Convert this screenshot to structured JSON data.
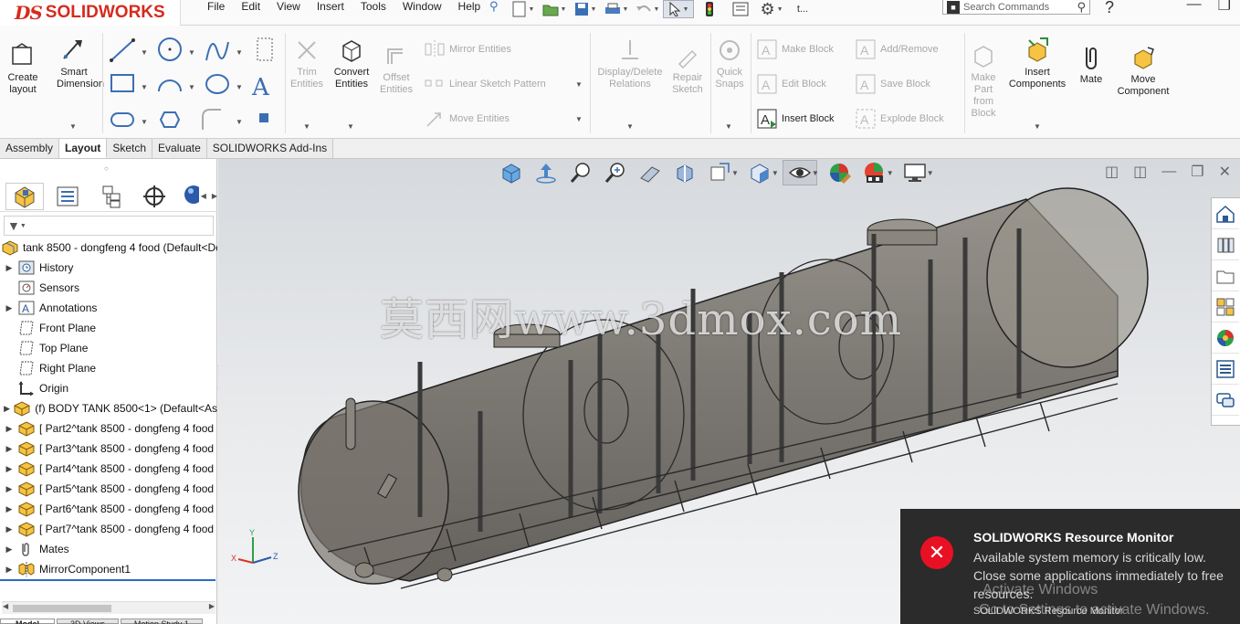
{
  "app": {
    "brand_prefix": "DS",
    "brand_name": "SOLIDWORKS"
  },
  "menu": [
    "File",
    "Edit",
    "View",
    "Insert",
    "Tools",
    "Window",
    "Help"
  ],
  "quickbar": {
    "truncated_label": "t..."
  },
  "search": {
    "placeholder": "Search Commands"
  },
  "ribbon": {
    "create_layout": "Create\nlayout",
    "smart_dimension": "Smart\nDimension",
    "trim_entities": "Trim\nEntities",
    "convert_entities": "Convert\nEntities",
    "offset_entities": "Offset\nEntities",
    "mirror_entities": "Mirror Entities",
    "linear_sketch_pattern": "Linear Sketch Pattern",
    "move_entities": "Move Entities",
    "display_delete_relations": "Display/Delete\nRelations",
    "repair_sketch": "Repair\nSketch",
    "quick_snaps": "Quick\nSnaps",
    "make_block": "Make Block",
    "edit_block": "Edit Block",
    "insert_block": "Insert Block",
    "add_remove": "Add/Remove",
    "save_block": "Save Block",
    "explode_block": "Explode Block",
    "make_part_from_block": "Make\nPart\nfrom\nBlock",
    "insert_components": "Insert\nComponents",
    "mate": "Mate",
    "move_component": "Move\nComponent"
  },
  "tabs": [
    {
      "label": "Assembly",
      "active": false
    },
    {
      "label": "Layout",
      "active": true
    },
    {
      "label": "Sketch",
      "active": false
    },
    {
      "label": "Evaluate",
      "active": false
    },
    {
      "label": "SOLIDWORKS Add-Ins",
      "active": false
    }
  ],
  "tree": {
    "root": "tank 8500 - dongfeng 4 food  (Default<Def",
    "items": [
      {
        "label": "History",
        "icon": "history-icon",
        "arrow": true
      },
      {
        "label": "Sensors",
        "icon": "sensors-icon",
        "arrow": false
      },
      {
        "label": "Annotations",
        "icon": "annotations-icon",
        "arrow": true
      },
      {
        "label": "Front Plane",
        "icon": "plane-icon",
        "arrow": false
      },
      {
        "label": "Top Plane",
        "icon": "plane-icon",
        "arrow": false
      },
      {
        "label": "Right Plane",
        "icon": "plane-icon",
        "arrow": false
      },
      {
        "label": "Origin",
        "icon": "origin-icon",
        "arrow": false
      },
      {
        "label": "(f) BODY TANK 8500<1> (Default<As",
        "icon": "part-icon",
        "arrow": true
      },
      {
        "label": "[ Part2^tank 8500 - dongfeng 4 food",
        "icon": "part-icon",
        "arrow": true
      },
      {
        "label": "[ Part3^tank 8500 - dongfeng 4 food",
        "icon": "part-icon",
        "arrow": true
      },
      {
        "label": "[ Part4^tank 8500 - dongfeng 4 food",
        "icon": "part-icon",
        "arrow": true
      },
      {
        "label": "[ Part5^tank 8500 - dongfeng 4 food",
        "icon": "part-icon",
        "arrow": true
      },
      {
        "label": "[ Part6^tank 8500 - dongfeng 4 food",
        "icon": "part-icon",
        "arrow": true
      },
      {
        "label": "[ Part7^tank 8500 - dongfeng 4 food",
        "icon": "part-icon",
        "arrow": true
      },
      {
        "label": "Mates",
        "icon": "mates-icon",
        "arrow": true
      },
      {
        "label": "MirrorComponent1",
        "icon": "mirror-component-icon",
        "arrow": true
      }
    ]
  },
  "bottom_tabs": [
    "Model",
    "3D Views",
    "Motion Study 1"
  ],
  "viewport": {
    "watermark": "莫西网www.3dmox.com",
    "triad": {
      "x": "X",
      "y": "Y",
      "z": "Z"
    }
  },
  "notification": {
    "title": "SOLIDWORKS Resource Monitor",
    "body": "Available system memory is critically low. Close some applications immediately to free resources.",
    "footer": "SOLIDWORKS Resource Monitor",
    "activation_line1": "Activate Windows",
    "activation_line2": "Go to Settings to activate Windows."
  },
  "colors": {
    "brand": "#d52b1e",
    "toast_bg": "#2b2b2b",
    "error": "#e81123",
    "accent": "#3b6fb4"
  }
}
